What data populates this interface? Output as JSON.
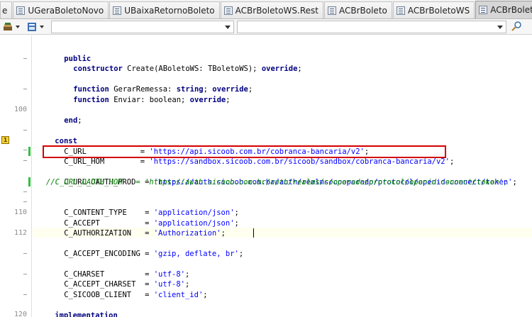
{
  "tabs": [
    {
      "label": "e"
    },
    {
      "label": "UGeraBoletoNovo"
    },
    {
      "label": "UBaixaRetornoBoleto"
    },
    {
      "label": "ACBrBoletoWS.Rest"
    },
    {
      "label": "ACBrBoleto"
    },
    {
      "label": "ACBrBoletoWS"
    },
    {
      "label": "ACBrBoletoW_Bancoob"
    }
  ],
  "gutter": {
    "line_numbers": [
      "100",
      "110",
      "112",
      "120"
    ],
    "bookmark": "1"
  },
  "code": {
    "l1_kw": "public",
    "l2_kw": "constructor",
    "l2_rest": " Create(ABoletoWS: TBoletoWS); ",
    "l2_kw2": "override",
    "l2_end": ";",
    "l4_kw": "function",
    "l4_rest": " GerarRemessa: ",
    "l4_kw2": "string",
    "l4_mid": "; ",
    "l4_kw3": "override",
    "l4_end": ";",
    "l5_kw": "function",
    "l5_rest": " Enviar: boolean; ",
    "l5_kw2": "override",
    "l5_end": ";",
    "l7_kw": "end",
    "l7_end": ";",
    "l9_kw": "const",
    "c_url_name": "C_URL            = ",
    "c_url_val": "'https://api.sicoob.com.br/cobranca-bancaria/v2'",
    "c_url_hom_name": "C_URL_HOM        = ",
    "c_url_hom_val": "'https://sandbox.sicoob.com.br/sicoob/sandbox/cobranca-bancaria/v2'",
    "c_oauth_name": "C_URL_OAUTH_PROD  = ",
    "c_oauth_val": "'https://auth.sicoob.com.br/auth/realms/cooperado/protocol/openid-connect/token'",
    "c_oauth_hom_comment": "//C_URL_OAUTH_HOM   = 'https://auth.sicoob.com.br/auth/realms/cooperado/protocol/openid-connect/token';",
    "c_ct_name": "C_CONTENT_TYPE    = ",
    "c_ct_val": "'application/json'",
    "c_acc_name": "C_ACCEPT          = ",
    "c_acc_val": "'application/json'",
    "c_auth_name": "C_AUTHORIZATION   = ",
    "c_auth_val": "'Authorization'",
    "c_enc_name": "C_ACCEPT_ENCODING = ",
    "c_enc_val": "'gzip, deflate, br'",
    "c_charset_name": "C_CHARSET         = ",
    "c_charset_val": "'utf-8'",
    "c_acc_charset_name": "C_ACCEPT_CHARSET  = ",
    "c_acc_charset_val": "'utf-8'",
    "c_client_name": "C_SICOOB_CLIENT   = ",
    "c_client_val": "'client_id'",
    "semi": ";",
    "impl_kw": "implementation"
  },
  "colors": {
    "keyword": "#000080",
    "string": "#0000ff",
    "comment": "#008000",
    "highlight_box": "#d40000",
    "change_bar": "#2fbf40"
  }
}
